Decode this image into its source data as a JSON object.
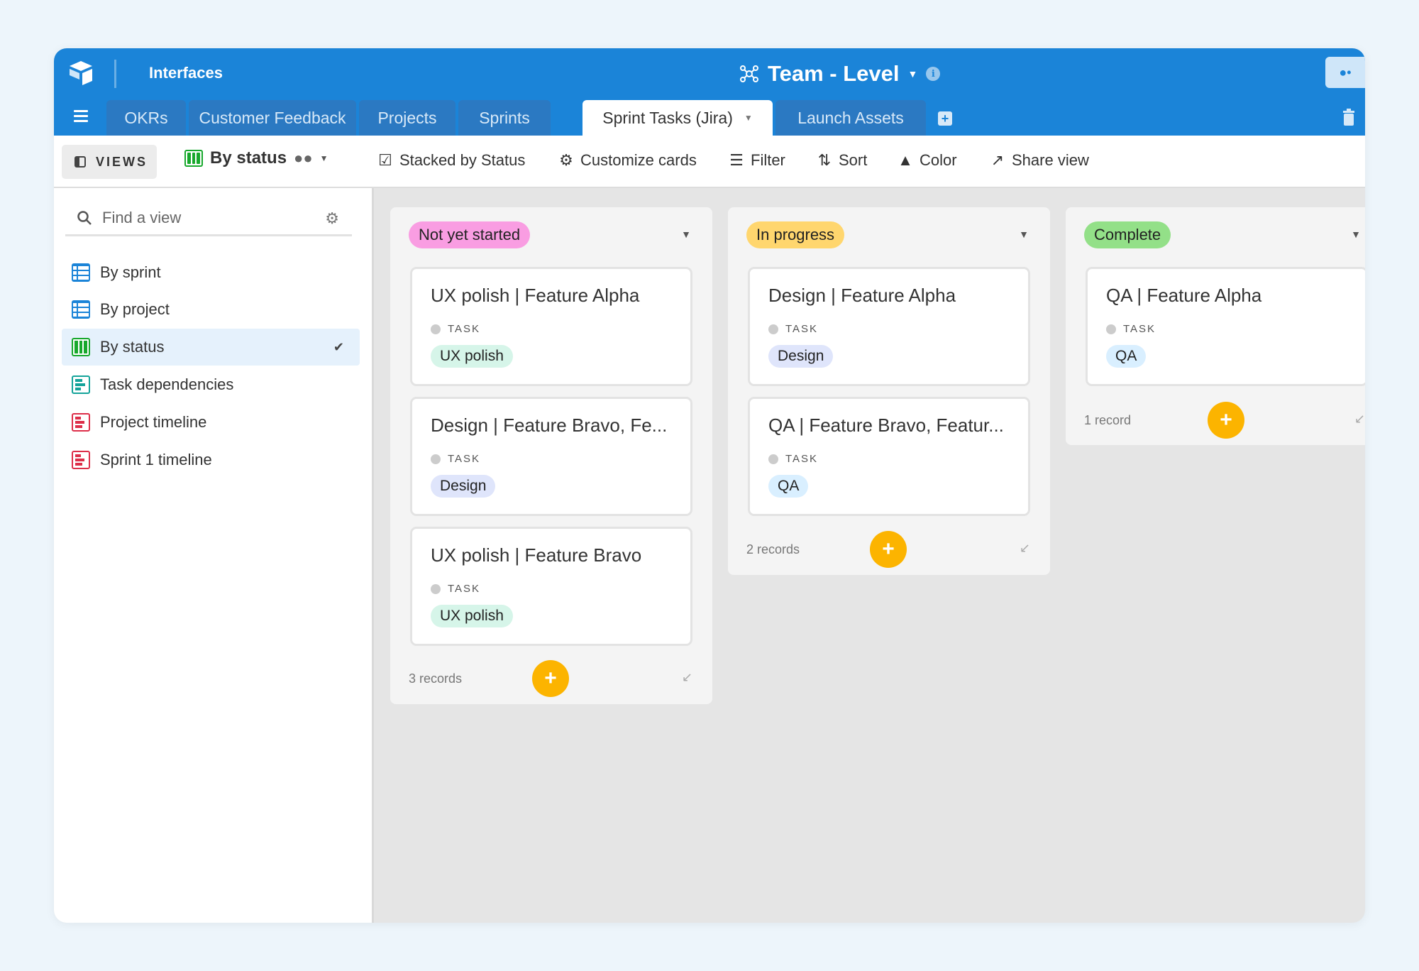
{
  "app": {
    "section_label": "Interfaces",
    "base_title": "Team - Level",
    "icons": {
      "logo": "airtable-logo-icon",
      "base": "molecule-icon",
      "info": "info-icon",
      "share": "share-people-icon"
    }
  },
  "tabs": [
    {
      "label": "OKRs",
      "active": false
    },
    {
      "label": "Customer Feedback",
      "active": false
    },
    {
      "label": "Projects",
      "active": false
    },
    {
      "label": "Sprints",
      "active": false
    },
    {
      "label": "Sprint Tasks (Jira)",
      "active": true
    },
    {
      "label": "Launch Assets",
      "active": false
    }
  ],
  "toolbar": {
    "views_label": "VIEWS",
    "current_view": "By status",
    "stacked_label": "Stacked by Status",
    "customize_label": "Customize cards",
    "filter_label": "Filter",
    "sort_label": "Sort",
    "color_label": "Color",
    "share_label": "Share view"
  },
  "sidebar": {
    "search_placeholder": "Find a view",
    "items": [
      {
        "label": "By sprint",
        "icon": "grid-icon",
        "selected": false
      },
      {
        "label": "By project",
        "icon": "grid-icon",
        "selected": false
      },
      {
        "label": "By status",
        "icon": "kanban-icon",
        "selected": true
      },
      {
        "label": "Task dependencies",
        "icon": "gantt-icon",
        "selected": false
      },
      {
        "label": "Project timeline",
        "icon": "timeline-icon",
        "selected": false
      },
      {
        "label": "Sprint 1 timeline",
        "icon": "timeline-icon",
        "selected": false
      }
    ]
  },
  "board": {
    "field_label": "TASK",
    "columns": [
      {
        "status": "Not yet started",
        "color": "#f99de2",
        "records": "3 records",
        "cards": [
          {
            "title": "UX polish | Feature Alpha",
            "tag": "UX polish"
          },
          {
            "title": "Design | Feature Bravo, Fe...",
            "tag": "Design"
          },
          {
            "title": "UX polish | Feature Bravo",
            "tag": "UX polish"
          }
        ]
      },
      {
        "status": "In progress",
        "color": "#ffd66e",
        "records": "2 records",
        "cards": [
          {
            "title": "Design | Feature Alpha",
            "tag": "Design"
          },
          {
            "title": "QA | Feature Bravo, Featur...",
            "tag": "QA"
          }
        ]
      },
      {
        "status": "Complete",
        "color": "#93e088",
        "records": "1 record",
        "cards": [
          {
            "title": "QA | Feature Alpha",
            "tag": "QA"
          }
        ]
      }
    ]
  },
  "colors": {
    "brand": "#1b84d8",
    "add_button": "#fcb400"
  }
}
